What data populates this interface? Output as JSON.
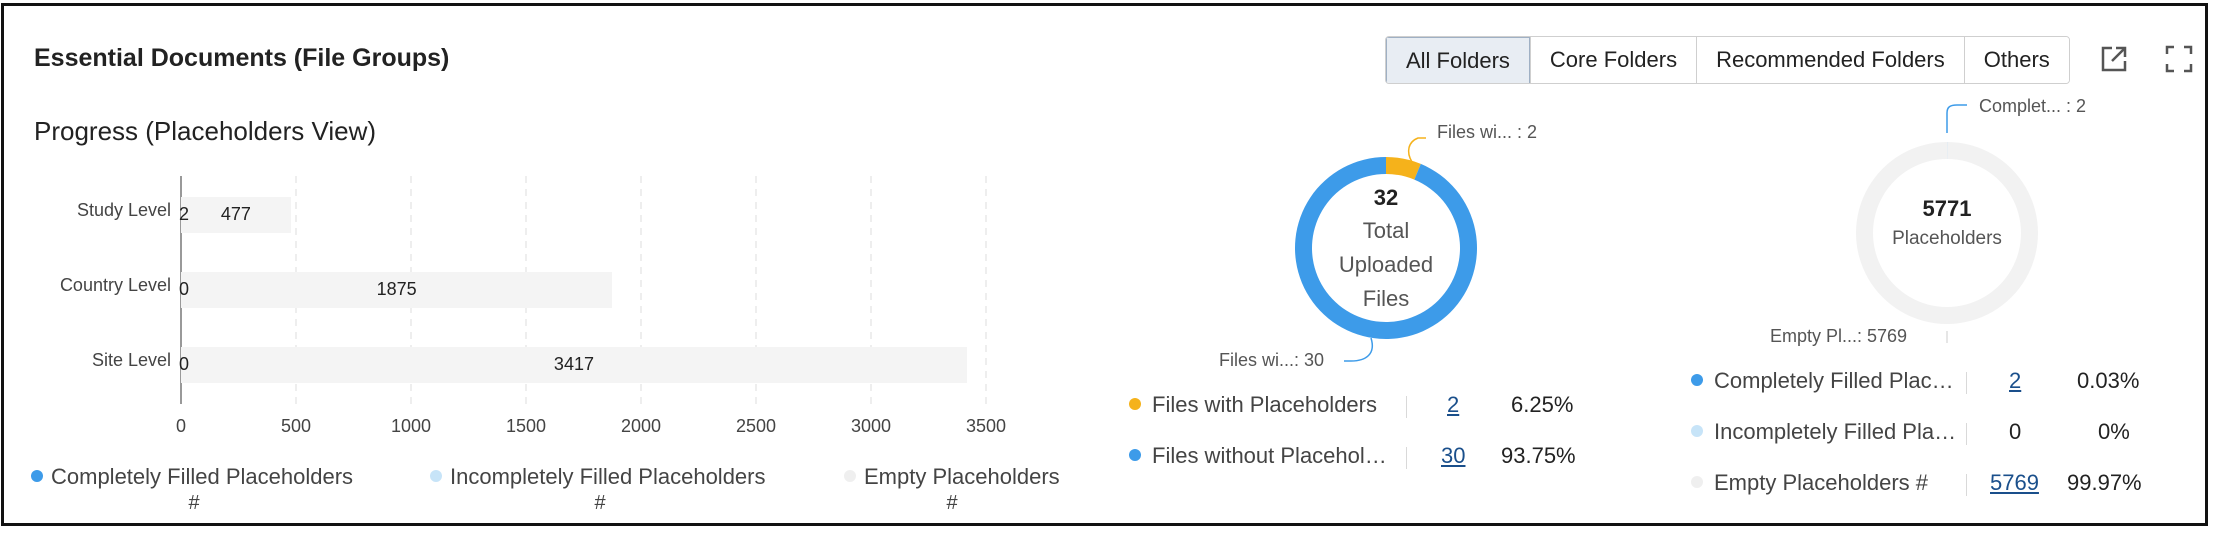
{
  "header": {
    "title": "Essential Documents (File Groups)",
    "tabs": [
      {
        "label": "All Folders",
        "active": true
      },
      {
        "label": "Core Folders",
        "active": false
      },
      {
        "label": "Recommended Folders",
        "active": false
      },
      {
        "label": "Others",
        "active": false
      }
    ],
    "icons": [
      "open-external-icon",
      "fullscreen-icon"
    ]
  },
  "progress": {
    "title": "Progress (Placeholders View)",
    "x_ticks": [
      "0",
      "500",
      "1000",
      "1500",
      "2000",
      "2500",
      "3000",
      "3500"
    ],
    "rows": [
      {
        "label": "Study Level",
        "completely_filled": "2",
        "incompletely_filled": "0",
        "empty": 477,
        "empty_label": "477"
      },
      {
        "label": "Country Level",
        "completely_filled": "0",
        "incompletely_filled": "0",
        "empty": 1875,
        "empty_label": "1875"
      },
      {
        "label": "Site Level",
        "completely_filled": "0",
        "incompletely_filled": "0",
        "empty": 3417,
        "empty_label": "3417"
      }
    ],
    "legend": [
      {
        "label": "Completely Filled Placeholders",
        "sub": "#",
        "color": "#3d9be9"
      },
      {
        "label": "Incompletely Filled Placeholders",
        "sub": "#",
        "color": "#c7e4f8"
      },
      {
        "label": "Empty Placeholders",
        "sub": "#",
        "color": "#efefef"
      }
    ]
  },
  "files_donut": {
    "center_value": "32",
    "center_lines": [
      "Total",
      "Uploaded",
      "Files"
    ],
    "callouts": [
      {
        "label": "Files wi...  : 2"
      },
      {
        "label": "Files wi...: 30"
      }
    ],
    "rows": [
      {
        "label": "Files with Placeholders",
        "count": "2",
        "percent": "6.25%",
        "color": "#f5b21b"
      },
      {
        "label": "Files without Placehol…",
        "count": "30",
        "percent": "93.75%",
        "color": "#3d9be9"
      }
    ]
  },
  "placeholders_donut": {
    "center_value": "5771",
    "center_label": "Placeholders",
    "callouts": [
      {
        "label": "Complet...  : 2"
      },
      {
        "label": "Empty Pl...: 5769"
      }
    ],
    "rows": [
      {
        "label": "Completely Filled Plac…",
        "count": "2",
        "percent": "0.03%",
        "color": "#3d9be9",
        "link": true
      },
      {
        "label": "Incompletely Filled Pla…",
        "count": "0",
        "percent": "0%",
        "color": "#c7e4f8",
        "link": false
      },
      {
        "label": "Empty Placeholders #",
        "count": "5769",
        "percent": "99.97%",
        "color": "#efefef",
        "link": true
      }
    ]
  },
  "chart_data": [
    {
      "type": "bar",
      "orientation": "horizontal",
      "title": "Progress (Placeholders View)",
      "categories": [
        "Study Level",
        "Country Level",
        "Site Level"
      ],
      "series": [
        {
          "name": "Completely Filled Placeholders #",
          "values": [
            2,
            0,
            0
          ]
        },
        {
          "name": "Incompletely Filled Placeholders #",
          "values": [
            0,
            0,
            0
          ]
        },
        {
          "name": "Empty Placeholders #",
          "values": [
            477,
            1875,
            3417
          ]
        }
      ],
      "xlim": [
        0,
        3500
      ],
      "grid": true,
      "legend": "bottom"
    },
    {
      "type": "pie",
      "donut": true,
      "labels": [
        "Files with Placeholders",
        "Files without Placeholders"
      ],
      "values": [
        2,
        30
      ],
      "center_text": "32 Total Uploaded Files"
    },
    {
      "type": "pie",
      "donut": true,
      "labels": [
        "Completely Filled Placeholders",
        "Incompletely Filled Placeholders",
        "Empty Placeholders"
      ],
      "values": [
        2,
        0,
        5769
      ],
      "center_text": "5771 Placeholders"
    }
  ]
}
